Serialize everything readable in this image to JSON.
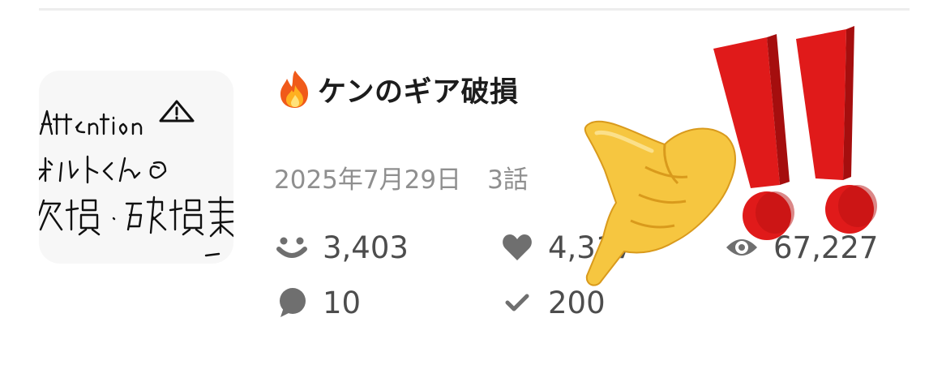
{
  "story": {
    "title": "ケンのギア破損",
    "title_emoji": "fire-emoji",
    "date": "2025年7月29日",
    "episodes": "3話"
  },
  "thumbnail": {
    "handwritten_lines": [
      "Attention⚠",
      "オルトくんの",
      "欠損・破損表"
    ]
  },
  "stats": {
    "readers": "3,403",
    "likes": "4,317",
    "views": "67,227",
    "comments": "10",
    "bookmarks": "200"
  },
  "icons": {
    "readers": "smile-face-icon",
    "likes": "heart-icon",
    "views": "eye-icon",
    "comments": "speech-bubble-icon",
    "bookmarks": "checkmark-icon"
  },
  "overlay": {
    "pointing_hand": "pointing-hand-emoji",
    "exclamation": "double-exclamation-emoji"
  },
  "colors": {
    "title": "#1c1c1c",
    "meta": "#8f8f8f",
    "stat_icon": "#6f6f6f",
    "exclamation_red": "#e01a1a",
    "hand_yellow": "#f6c640"
  }
}
